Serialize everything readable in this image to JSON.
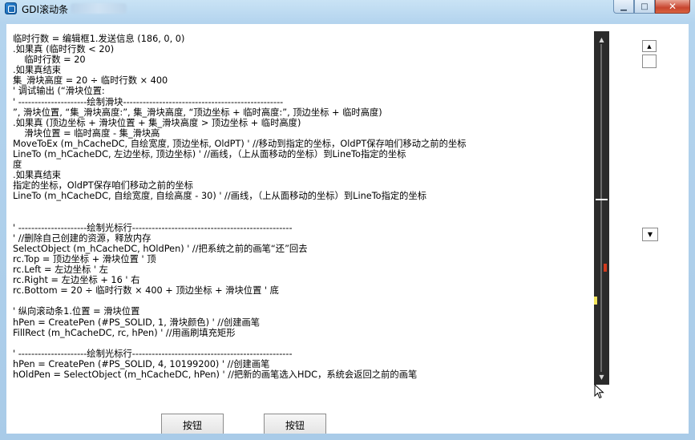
{
  "window": {
    "title": "GDI滚动条",
    "minimize_glyph": "▁",
    "maximize_glyph": "□",
    "close_glyph": "✕"
  },
  "code_lines": [
    "临时行数 = 编辑框1.发送信息 (186, 0, 0)",
    ".如果真 (临时行数 < 20)",
    "    临时行数 = 20",
    ".如果真结束",
    "集_滑块高度 = 20 ÷ 临时行数 × 400",
    "' 调试输出 (“滑块位置:",
    "' ---------------------绘制滑块-------------------------------------------------",
    "”, 滑块位置, “集_滑块高度:”, 集_滑块高度, “顶边坐标 + 临时高度:”, 顶边坐标 + 临时高度)",
    ".如果真 (顶边坐标 + 滑块位置 + 集_滑块高度 > 顶边坐标 + 临时高度)",
    "    滑块位置 = 临时高度 - 集_滑块高",
    "MoveToEx (m_hCacheDC, 自绘宽度, 顶边坐标, OldPT) ' //移动到指定的坐标，OldPT保存咱们移动之前的坐标",
    "LineTo (m_hCacheDC, 左边坐标, 顶边坐标) ' //画线，（上从面移动的坐标）到LineTo指定的坐标",
    "度",
    ".如果真结束",
    "指定的坐标，OldPT保存咱们移动之前的坐标",
    "LineTo (m_hCacheDC, 自绘宽度, 自绘高度 - 30) ' //画线，（上从面移动的坐标）到LineTo指定的坐标",
    "",
    "",
    "' ---------------------绘制光标行-------------------------------------------------",
    "' //删除自己创建的资源，释放内存",
    "SelectObject (m_hCacheDC, hOldPen) ' //把系统之前的画笔“还”回去",
    "rc.Top = 顶边坐标 + 滑块位置 ' 顶",
    "rc.Left = 左边坐标 ' 左",
    "rc.Right = 左边坐标 + 16 ' 右",
    "rc.Bottom = 20 ÷ 临时行数 × 400 + 顶边坐标 + 滑块位置 ' 底",
    "",
    "' 纵向滚动条1.位置 = 滑块位置",
    "hPen = CreatePen (#PS_SOLID, 1, 滑块颜色) ' //创建画笔",
    "FillRect (m_hCacheDC, rc, hPen) ' //用画刷填充矩形",
    "",
    "' ---------------------绘制光标行-------------------------------------------------",
    "hPen = CreatePen (#PS_SOLID, 4, 10199200) ' //创建画笔",
    "hOldPen = SelectObject (m_hCacheDC, hPen) ' //把新的画笔选入HDC，系统会返回之前的画笔"
  ],
  "scrollbar": {
    "up_glyph": "▲",
    "down_glyph": "▼",
    "thumb_top_fraction": 0.04,
    "thumb_bottom_fraction": 0.5,
    "marker_red_fraction": 0.67,
    "marker_yellow_fraction": 0.77,
    "red": "#d23a1e",
    "yellow": "#f2e45c"
  },
  "small_scroll": {
    "up_glyph": "▲",
    "combo_glyph": "▼"
  },
  "buttons": {
    "button1_label": "按钮",
    "button2_label": "按钮"
  }
}
